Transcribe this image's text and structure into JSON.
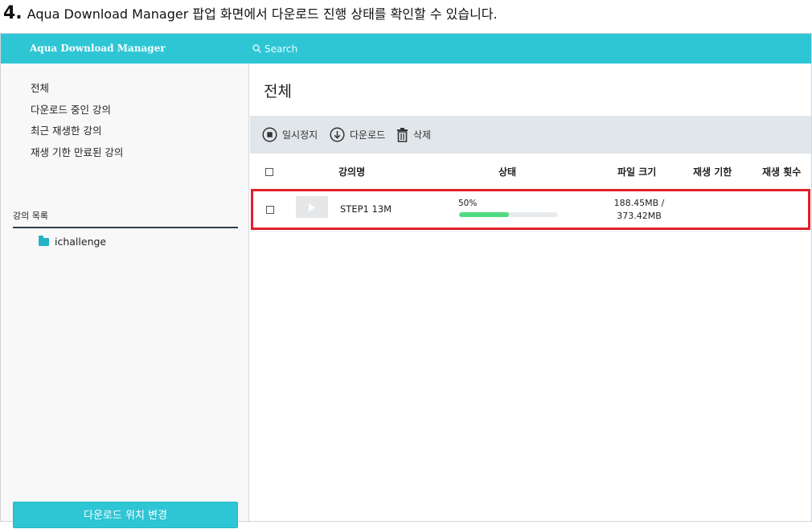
{
  "caption": {
    "number": "4.",
    "text": "Aqua Download Manager 팝업 화면에서 다운로드 진행 상태를 확인할 수 있습니다."
  },
  "header": {
    "app_title": "Aqua Download Manager",
    "search_placeholder": "Search",
    "search_icon": "search-icon"
  },
  "sidebar": {
    "filters": [
      "전체",
      "다운로드 중인 강의",
      "최근 재생한 강의",
      "재생 기한 만료된 강의"
    ],
    "section_title": "강의 목록",
    "folders": [
      {
        "label": "ichallenge",
        "icon": "folder-icon"
      }
    ],
    "location_button": "다운로드 위치 변경"
  },
  "main": {
    "title": "전체",
    "toolbar": {
      "pause": "일시정지",
      "download": "다운로드",
      "delete": "삭제"
    },
    "columns": {
      "name": "강의명",
      "status": "상태",
      "size": "파일 크기",
      "expiry": "재생 기한",
      "plays": "재생 횟수"
    },
    "rows": [
      {
        "name": "STEP1 13M",
        "progress_label": "50%",
        "progress": 0.5,
        "size_line1": "188.45MB /",
        "size_line2": "373.42MB",
        "expiry": "",
        "plays": ""
      }
    ]
  },
  "colors": {
    "accent": "#2ec6d5",
    "progress": "#4fda80",
    "highlight": "#e0202a"
  }
}
